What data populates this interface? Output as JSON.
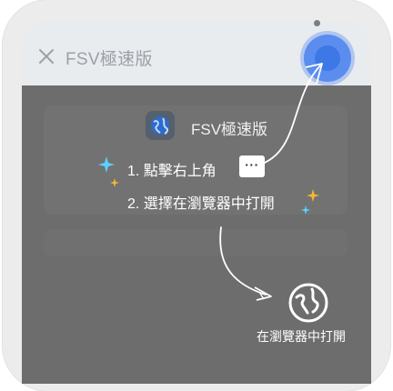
{
  "browser_bar": {
    "title": "FSV極速版",
    "close_icon": "close-icon"
  },
  "guide": {
    "app_name": "FSV極速版",
    "app_icon": "globe-app-icon",
    "step1": "1.  點擊右上角",
    "more_button_label": "···",
    "step2": "2.  選擇在瀏覽器中打開",
    "open_in_browser_label": "在瀏覽器中打開",
    "open_in_browser_icon": "globe-icon"
  },
  "colors": {
    "overlay": "#6d6d6d",
    "highlight": "#3e78e6",
    "spark_blue": "#5ad2ff",
    "spark_gold": "#f5b82e"
  }
}
